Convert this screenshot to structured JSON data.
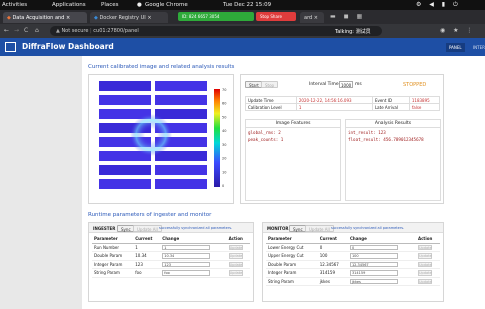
{
  "system": {
    "activities": "Activities",
    "applications": "Applications",
    "places": "Places",
    "active_app": "Google Chrome",
    "clock": "Tue Dec 22  15:09",
    "recording_label": "ID: 824 6657 3054",
    "share_label": "Stop Share",
    "overlay_text": "Talking: 测试员",
    "colors": {
      "record": "#2eaa3a",
      "share": "#e03c3c"
    }
  },
  "browser": {
    "tabs": [
      {
        "label": "Data Acquisition and",
        "icon": "fox-icon"
      },
      {
        "label": "Docker Registry UI",
        "icon": "docker-icon"
      },
      {
        "label": "ard",
        "icon": "page-icon"
      }
    ],
    "url_security": "Not secure",
    "url": "cu01:27800/panel"
  },
  "app": {
    "title": "DiffraFlow Dashboard",
    "nav": [
      "PANEL",
      "INTER"
    ],
    "colors": {
      "header": "#1e4fa5",
      "accent": "#2a58b8"
    }
  },
  "section1": {
    "title": "Current calibrated image and related analysis results",
    "start_label": "Start",
    "stop_label": "Stop",
    "interval_label": "Interval Time:",
    "interval_value": "1000",
    "interval_unit": "ms",
    "status": "STOPPED",
    "info": [
      {
        "label": "Update Time",
        "value": "2020-12-22, 14:56:16.093",
        "label2": "Event ID",
        "value2": "1183895"
      },
      {
        "label": "Calibration Level",
        "value": "1",
        "label2": "Late Arrival",
        "value2": "false"
      }
    ],
    "features": {
      "title": "Image Features",
      "lines": [
        "global_rms: 2",
        "peak_counts: 1"
      ]
    },
    "results": {
      "title": "Analysis Results",
      "lines": [
        "int_result: 123",
        "float_result: 456.789012345678"
      ]
    }
  },
  "section2": {
    "title": "Runtime parameters of ingester and monitor",
    "ingester": {
      "name": "INGESTER",
      "sync_label": "Sync",
      "sync2_label": "Update All",
      "message": "successfully synchronized all parameters.",
      "headers": [
        "Parameter",
        "Current",
        "Change",
        "Action"
      ],
      "rows": [
        {
          "param": "Run Number",
          "current": "1",
          "change": "1"
        },
        {
          "param": "Double Param",
          "current": "10.34",
          "change": "10.34"
        },
        {
          "param": "Integer Param",
          "current": "123",
          "change": "123"
        },
        {
          "param": "String Param",
          "current": "foo",
          "change": "foo"
        }
      ],
      "action_label": "Update"
    },
    "monitor": {
      "name": "MONITOR",
      "sync_label": "Sync",
      "sync2_label": "Update All",
      "message": "successfully synchronized all parameters.",
      "headers": [
        "Parameter",
        "Current",
        "Change",
        "Action"
      ],
      "rows": [
        {
          "param": "Lower Energy Cut",
          "current": "0",
          "change": "0"
        },
        {
          "param": "Upper Energy Cut",
          "current": "100",
          "change": "100"
        },
        {
          "param": "Double Param",
          "current": "12.34567",
          "change": "12.34567"
        },
        {
          "param": "Integer Param",
          "current": "314159",
          "change": "314159"
        },
        {
          "param": "String Param",
          "current": "jkkes",
          "change": "jkkes"
        }
      ],
      "action_label": "Update"
    }
  },
  "colorbar_ticks": [
    "70",
    "60",
    "50",
    "40",
    "30",
    "20",
    "10",
    "0"
  ]
}
